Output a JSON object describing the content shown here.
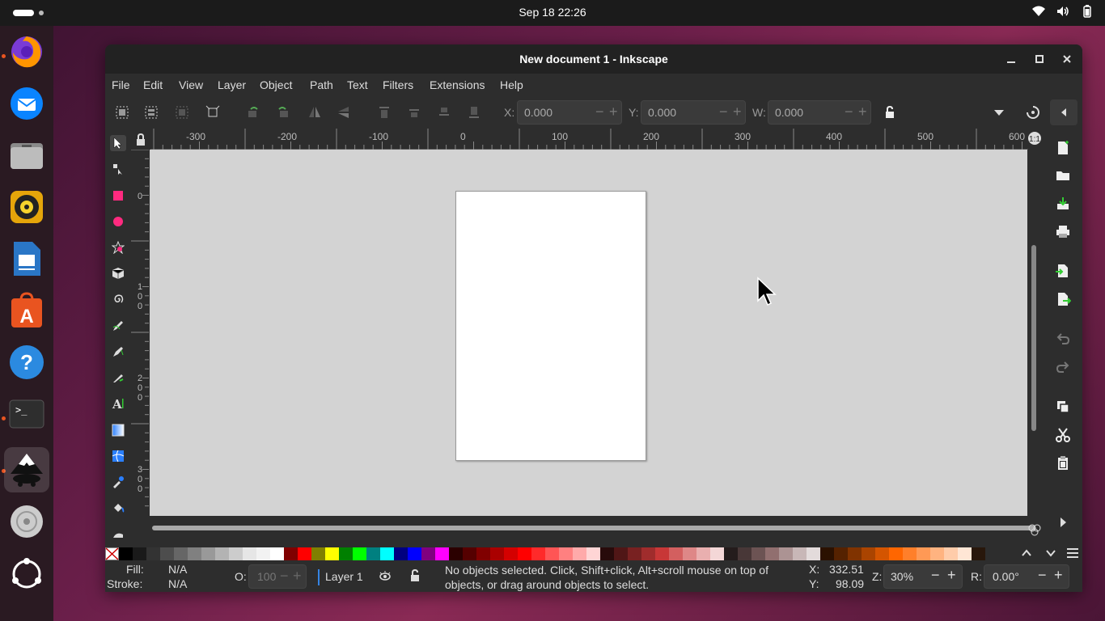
{
  "topbar": {
    "clock": "Sep 18  22:26"
  },
  "dock": {
    "apps": [
      "Firefox",
      "Thunderbird",
      "Files",
      "Rhythmbox",
      "LibreOffice Writer",
      "App Center",
      "Help",
      "Terminal",
      "Inkscape",
      "Disc",
      "Show Apps"
    ]
  },
  "window": {
    "title": "New document 1 - Inkscape",
    "menu": [
      "File",
      "Edit",
      "View",
      "Layer",
      "Object",
      "Path",
      "Text",
      "Filters",
      "Extensions",
      "Help"
    ],
    "toolbar": {
      "x_label": "X:",
      "x_value": "0.000",
      "y_label": "Y:",
      "y_value": "0.000",
      "w_label": "W:",
      "w_value": "0.000"
    },
    "ruler": {
      "h_labels": [
        "-300",
        "-200",
        "-100",
        "0",
        "100",
        "200",
        "300",
        "400",
        "500",
        "600"
      ],
      "v_labels": [
        "0",
        "1\n0\n0",
        "2\n0\n0",
        "3\n0\n0"
      ]
    },
    "status": {
      "fill_label": "Fill:",
      "fill_value": "N/A",
      "stroke_label": "Stroke:",
      "stroke_value": "N/A",
      "opacity_label": "O:",
      "opacity_value": "100",
      "layer": "Layer 1",
      "message": "No objects selected. Click, Shift+click, Alt+scroll mouse on top of objects, or drag around objects to select.",
      "x_label": "X:",
      "x_value": "332.51",
      "y_label": "Y:",
      "y_value": "98.09",
      "zoom_label": "Z:",
      "zoom_value": "30%",
      "rotation_label": "R:",
      "rotation_value": "0.00°"
    },
    "palette": [
      "#000000",
      "#1a1a1a",
      "#333333",
      "#4d4d4d",
      "#666666",
      "#808080",
      "#999999",
      "#b3b3b3",
      "#cccccc",
      "#e6e6e6",
      "#f2f2f2",
      "#ffffff",
      "#800000",
      "#ff0000",
      "#808000",
      "#ffff00",
      "#008000",
      "#00ff00",
      "#008080",
      "#00ffff",
      "#000080",
      "#0000ff",
      "#800080",
      "#ff00ff",
      "#2b0000",
      "#550000",
      "#800000",
      "#aa0000",
      "#d40000",
      "#ff0000",
      "#ff2a2a",
      "#ff5555",
      "#ff8080",
      "#ffaaaa",
      "#ffd5d5",
      "#280b0b",
      "#501616",
      "#782121",
      "#a02c2c",
      "#c83737",
      "#d35f5f",
      "#de8787",
      "#e9afaf",
      "#f4d7d7",
      "#241c1c",
      "#483737",
      "#6c5353",
      "#916f6f",
      "#ac9393",
      "#c8b7b7",
      "#e3dbdb",
      "#2b1100",
      "#552200",
      "#803300",
      "#aa4400",
      "#d45500",
      "#ff6600",
      "#ff7f2a",
      "#ff9955",
      "#ffb380",
      "#ffccaa",
      "#ffe6d5",
      "#28170b"
    ]
  }
}
